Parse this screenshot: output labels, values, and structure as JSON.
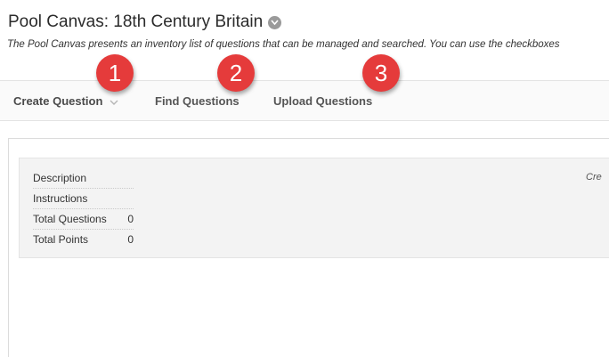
{
  "header": {
    "title": "Pool Canvas: 18th Century Britain",
    "description": "The Pool Canvas presents an inventory list of questions that can be managed and searched. You can use the checkboxes"
  },
  "action_bar": {
    "create_question": "Create Question",
    "find_questions": "Find Questions",
    "upload_questions": "Upload Questions"
  },
  "callouts": [
    "1",
    "2",
    "3"
  ],
  "info": {
    "rows": [
      {
        "label": "Description",
        "value": ""
      },
      {
        "label": "Instructions",
        "value": ""
      },
      {
        "label": "Total Questions",
        "value": "0"
      },
      {
        "label": "Total Points",
        "value": "0"
      }
    ]
  },
  "content": {
    "truncated_text": "Cre"
  },
  "colors": {
    "callout": "#e53b3b",
    "panel": "#f3f3f3"
  }
}
